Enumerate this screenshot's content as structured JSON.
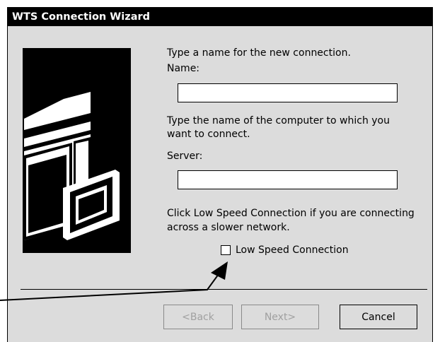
{
  "window": {
    "title": "WTS Connection Wizard"
  },
  "name_section": {
    "instruction": "Type a name for the new connection.",
    "label": "Name:",
    "value": ""
  },
  "server_section": {
    "instruction_line1": "Type the name of the computer to which you",
    "instruction_line2": "want to connect.",
    "label": "Server:",
    "value": ""
  },
  "speed_section": {
    "instruction_line1": "Click Low Speed Connection if you are connecting",
    "instruction_line2": "across a slower network.",
    "checkbox_label": "Low Speed Connection",
    "checked": false
  },
  "buttons": {
    "back": "<Back",
    "next": "Next>",
    "cancel": "Cancel"
  },
  "icons": [
    "server-tower-icon",
    "monitor-icon",
    "callout-arrow-icon"
  ],
  "colors": {
    "titlebar": "#000000",
    "dialog_bg": "#dcdcdc",
    "disabled_text": "#a0a0a0"
  }
}
